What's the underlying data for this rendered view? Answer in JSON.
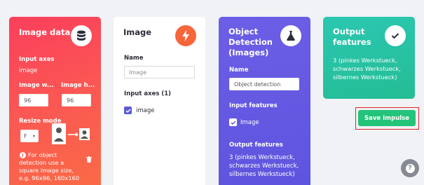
{
  "colors": {
    "image_data_card": "#fb4a56",
    "image_card": "#ffffff",
    "object_detection_card": "#6559e3",
    "output_card": "#27c2a3",
    "save_button": "#23c47a",
    "highlight_border": "#e0262b",
    "image_icon_bg": "#f7653a"
  },
  "image_data": {
    "title": "Image data",
    "icon": "database-icon",
    "input_axes_label": "Input axes",
    "input_axes_value": "image",
    "width_label": "Image w...",
    "height_label": "Image h...",
    "width_value": "96",
    "height_value": "96",
    "resize_mode_label": "Resize mode",
    "resize_mode_value": "F",
    "note": "For object detection use a square image size, e.g. 96x96, 160x160"
  },
  "image_block": {
    "title": "Image",
    "icon": "lightning-icon",
    "name_label": "Name",
    "name_placeholder": "Image",
    "input_axes_label": "Input axes (1)",
    "axis_item": "image"
  },
  "object_detection": {
    "title_line1": "Object",
    "title_line2": "Detection",
    "title_line3": "(Images)",
    "icon": "flask-icon",
    "name_label": "Name",
    "name_value": "Object detection",
    "input_features_label": "Input features",
    "feature_item": "Image",
    "output_features_label": "Output features",
    "output_line1": "3 (pinkes Werkstueck,",
    "output_line2": "schwarzes Werkstueck,",
    "output_line3": "silbernes Werkstueck)"
  },
  "output_features": {
    "title_line1": "Output",
    "title_line2": "features",
    "icon": "checkmark-icon",
    "line1": "3 (pinkes Werkstueck,",
    "line2": "schwarzes Werkstueck,",
    "line3": "silbernes Werkstueck)"
  },
  "actions": {
    "save_label": "Save Impulse",
    "help_icon": "help-icon"
  }
}
